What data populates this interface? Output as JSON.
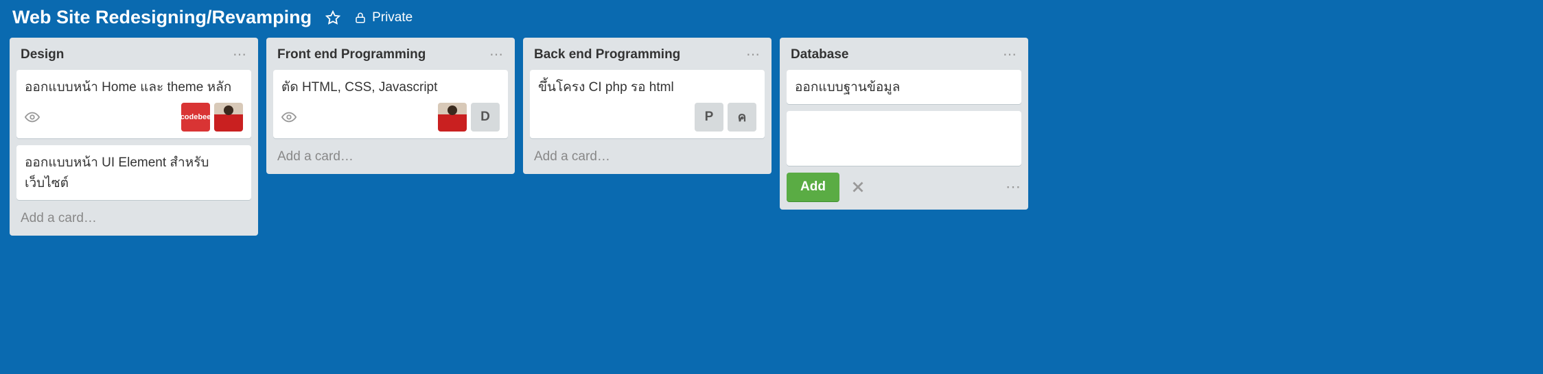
{
  "header": {
    "title": "Web Site Redesigning/Revamping",
    "privacy_label": "Private"
  },
  "lists": [
    {
      "title": "Design",
      "cards": [
        {
          "title": "ออกแบบหน้า Home และ theme หลัก",
          "watch": true,
          "members": [
            {
              "type": "codebee",
              "label": "codebee"
            },
            {
              "type": "photo"
            }
          ]
        },
        {
          "title": "ออกแบบหน้า UI Element สำหรับเว็บไซต์"
        }
      ],
      "add_label": "Add a card…"
    },
    {
      "title": "Front end Programming",
      "cards": [
        {
          "title": "ตัด HTML, CSS, Javascript",
          "watch": true,
          "members": [
            {
              "type": "photo"
            },
            {
              "type": "letter",
              "label": "D"
            }
          ]
        }
      ],
      "add_label": "Add a card…"
    },
    {
      "title": "Back end Programming",
      "cards": [
        {
          "title": "ขึ้นโครง CI php รอ html",
          "members": [
            {
              "type": "letter",
              "label": "P"
            },
            {
              "type": "letter",
              "label": "ค"
            }
          ]
        }
      ],
      "add_label": "Add a card…"
    },
    {
      "title": "Database",
      "cards": [
        {
          "title": "ออกแบบฐานข้อมูล"
        }
      ],
      "composer": {
        "add_button": "Add"
      }
    }
  ]
}
